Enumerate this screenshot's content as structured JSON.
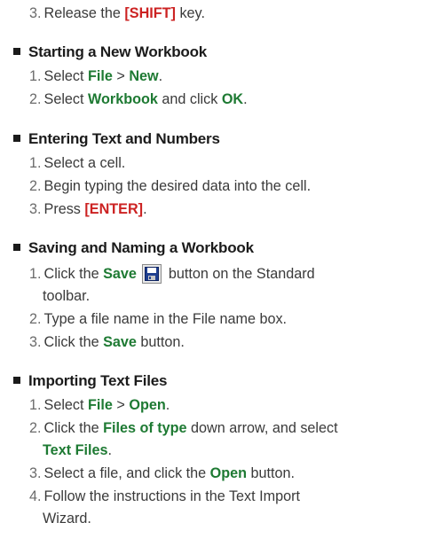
{
  "top_step": {
    "num": "3.",
    "pre": "Release the ",
    "key": "[SHIFT]",
    "post": " key."
  },
  "sections": {
    "new_workbook": {
      "title": "Starting a New Workbook",
      "s1": {
        "num": "1.",
        "pre": "Select ",
        "a": "File",
        "sep": " > ",
        "b": "New",
        "post": "."
      },
      "s2": {
        "num": "2.",
        "pre": "Select ",
        "a": "Workbook",
        "mid": " and click ",
        "b": "OK",
        "post": "."
      }
    },
    "entering": {
      "title": "Entering Text and Numbers",
      "s1": {
        "num": "1.",
        "text": "Select a cell."
      },
      "s2": {
        "num": "2.",
        "text": "Begin typing the desired data into the cell."
      },
      "s3": {
        "num": "3.",
        "pre": "Press ",
        "key": "[ENTER]",
        "post": "."
      }
    },
    "saving": {
      "title": "Saving and Naming a Workbook",
      "s1": {
        "num": "1.",
        "pre": "Click the ",
        "a": "Save",
        "post": "button on the Standard",
        "cont": "toolbar.",
        "icon": "save-disk-icon"
      },
      "s2": {
        "num": "2.",
        "text": "Type a file name in the File name box."
      },
      "s3": {
        "num": "3.",
        "pre": "Click the ",
        "a": "Save",
        "post": " button."
      }
    },
    "importing": {
      "title": "Importing Text Files",
      "s1": {
        "num": "1.",
        "pre": "Select ",
        "a": "File",
        "sep": " > ",
        "b": "Open",
        "post": "."
      },
      "s2": {
        "num": "2.",
        "pre": "Click the ",
        "a": "Files of type",
        "post": " down arrow, and select",
        "cont": "Text Files",
        "cont_post": "."
      },
      "s3": {
        "num": "3.",
        "pre": "Select a file, and click the ",
        "a": "Open",
        "post": " button."
      },
      "s4": {
        "num": "4.",
        "text": "Follow the instructions in the Text Import",
        "cont": "Wizard."
      }
    }
  },
  "colors": {
    "command": "#1e7a33",
    "key": "#cc2222",
    "text": "#3a3a3a",
    "heading": "#1b1b1b"
  }
}
